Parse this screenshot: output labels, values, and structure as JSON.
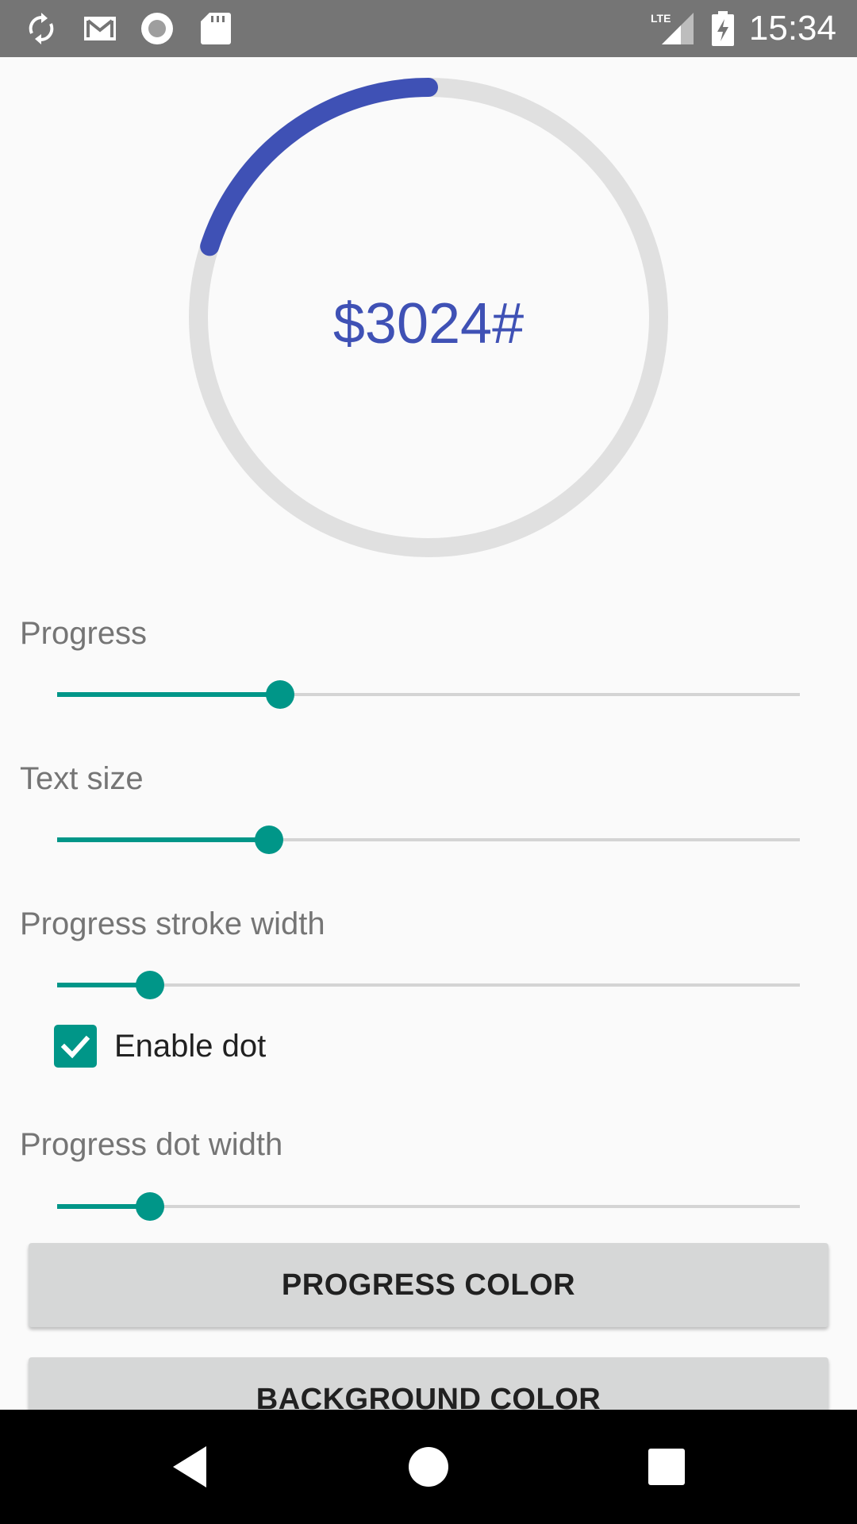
{
  "status_bar": {
    "time": "15:34",
    "network": "LTE",
    "left_icons": [
      "sync-icon",
      "gmail-icon",
      "record-icon",
      "sd-card-icon"
    ],
    "right_icons": [
      "lte-signal-icon",
      "battery-charging-icon"
    ]
  },
  "progress_view": {
    "text": "$3024#",
    "progress_fraction": 0.2,
    "progress_color": "#3f51b5",
    "background_color": "#e0e0e0"
  },
  "settings": {
    "progress": {
      "label": "Progress",
      "value_fraction": 0.3
    },
    "text_size": {
      "label": "Text size",
      "value_fraction": 0.285
    },
    "stroke_width": {
      "label": "Progress stroke width",
      "value_fraction": 0.125
    },
    "enable_dot": {
      "label": "Enable dot",
      "checked": true
    },
    "dot_width": {
      "label": "Progress dot width",
      "value_fraction": 0.125
    }
  },
  "buttons": {
    "progress_color": "PROGRESS COLOR",
    "background_color": "BACKGROUND COLOR"
  },
  "colors": {
    "accent": "#009688",
    "primary": "#3f51b5",
    "status_bar": "#757575",
    "nav_bar": "#000000"
  },
  "nav_bar": {
    "buttons": [
      "back-icon",
      "home-icon",
      "recents-icon"
    ]
  }
}
